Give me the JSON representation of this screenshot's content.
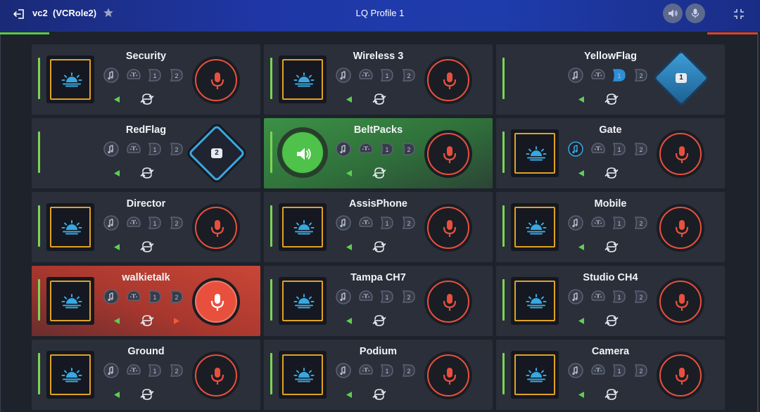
{
  "header": {
    "channel": "vc2",
    "role": "(VCRole2)",
    "profile": "LQ Profile 1"
  },
  "colors": {
    "header_blue": "#1f37a6",
    "talk_green": "#4ec24a",
    "mic_red": "#e8503d",
    "listen_orange": "#e0a126",
    "tally_blue": "#39a7e0",
    "level_green": "#7bd652"
  },
  "tiles": [
    {
      "name": "Security",
      "state": "normal",
      "left_widget": "listen",
      "icon_state": "none"
    },
    {
      "name": "Wireless 3",
      "state": "normal",
      "left_widget": "listen",
      "icon_state": "none"
    },
    {
      "name": "YellowFlag",
      "state": "normal",
      "left_widget": "none",
      "icon_state": "input-2",
      "badge": "1"
    },
    {
      "name": "RedFlag",
      "state": "normal",
      "left_widget": "none",
      "icon_state": "none",
      "badge": "2"
    },
    {
      "name": "BeltPacks",
      "state": "talk",
      "left_widget": "speaker",
      "icon_state": "none"
    },
    {
      "name": "Gate",
      "state": "normal",
      "left_widget": "listen",
      "icon_state": "music"
    },
    {
      "name": "Director",
      "state": "normal",
      "left_widget": "listen",
      "icon_state": "none"
    },
    {
      "name": "AssisPhone",
      "state": "normal",
      "left_widget": "listen",
      "icon_state": "none"
    },
    {
      "name": "Mobile",
      "state": "normal",
      "left_widget": "listen",
      "icon_state": "none"
    },
    {
      "name": "walkietalk",
      "state": "active",
      "left_widget": "listen",
      "icon_state": "none"
    },
    {
      "name": "Tampa CH7",
      "state": "normal",
      "left_widget": "listen",
      "icon_state": "none"
    },
    {
      "name": "Studio CH4",
      "state": "normal",
      "left_widget": "listen",
      "icon_state": "none"
    },
    {
      "name": "Ground",
      "state": "normal",
      "left_widget": "listen",
      "icon_state": "none"
    },
    {
      "name": "Podium",
      "state": "normal",
      "left_widget": "listen",
      "icon_state": "none"
    },
    {
      "name": "Camera",
      "state": "normal",
      "left_widget": "listen",
      "icon_state": "none"
    }
  ],
  "icons": {
    "exit": "exit-icon",
    "favorite": "star-icon",
    "volume": "speaker-icon",
    "microphone": "mic-icon",
    "collapse": "collapse-icon",
    "listen": "sunrise-icon",
    "talk": "mic-icon",
    "swap": "swap-icon",
    "music": "music-note-icon",
    "gauge": "gauge-icon",
    "input1": "input-1-icon",
    "input2": "input-2-icon"
  }
}
